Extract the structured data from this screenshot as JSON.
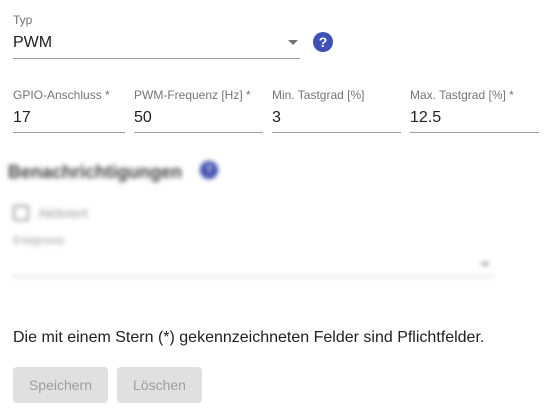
{
  "typ": {
    "label": "Typ",
    "value": "PWM"
  },
  "inputs": {
    "gpio": {
      "label": "GPIO-Anschluss *",
      "value": "17"
    },
    "frequency": {
      "label": "PWM-Frequenz [Hz] *",
      "value": "50"
    },
    "min_duty": {
      "label": "Min. Tastgrad [%]",
      "value": "3"
    },
    "max_duty": {
      "label": "Max. Tastgrad [%] *",
      "value": "12.5"
    }
  },
  "notifications": {
    "heading": "Benachrichtigungen",
    "checkbox_label": "Aktiviert",
    "events_label": "Ereignisse"
  },
  "help_glyph": "?",
  "required_note": "Die mit einem Stern (*) gekennzeichneten Felder sind Pflichtfelder.",
  "buttons": {
    "save": "Speichern",
    "delete": "Löschen"
  },
  "colors": {
    "accent": "#3f51b5",
    "disabled_bg": "#e0e0e0",
    "disabled_text": "#9e9e9e"
  }
}
